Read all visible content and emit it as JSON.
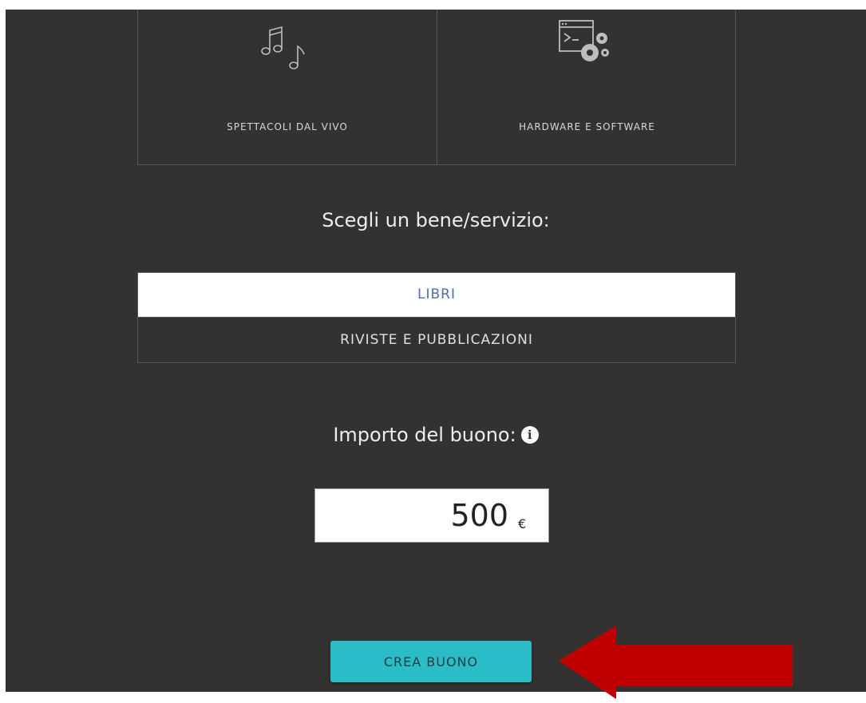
{
  "categories": [
    {
      "label": "SPETTACOLI DAL VIVO",
      "icon": "music-notes-icon"
    },
    {
      "label": "HARDWARE E SOFTWARE",
      "icon": "software-gears-icon"
    }
  ],
  "choose_heading": "Scegli un bene/servizio:",
  "options": [
    {
      "label": "LIBRI",
      "selected": true
    },
    {
      "label": "RIVISTE E PUBBLICAZIONI",
      "selected": false
    }
  ],
  "amount": {
    "heading": "Importo del buono:",
    "info_glyph": "i",
    "value": "500",
    "currency": "€"
  },
  "create_button": "CREA BUONO",
  "colors": {
    "panel": "#343230",
    "button": "#2bbdc7",
    "selected_text": "#4c6fa6",
    "annotation_arrow": "#c00000"
  }
}
